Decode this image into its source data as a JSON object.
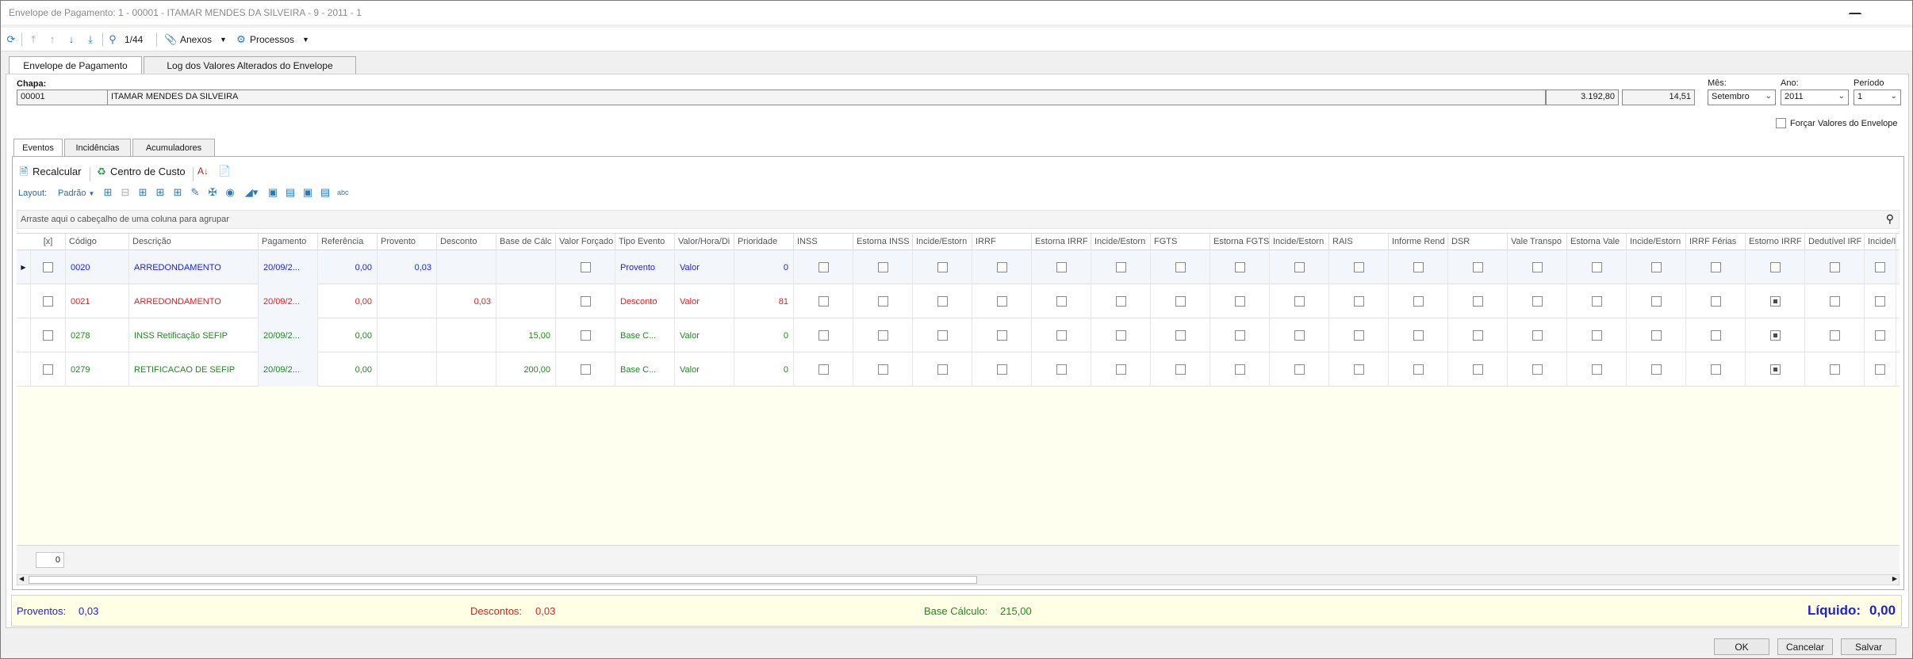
{
  "window": {
    "title": "Envelope de Pagamento: 1 - 00001 - ITAMAR MENDES DA SILVEIRA - 9 - 2011 - 1"
  },
  "toolbar": {
    "record_position": "1/44",
    "anexos": "Anexos",
    "processos": "Processos"
  },
  "main_tabs": [
    {
      "label": "Envelope de Pagamento"
    },
    {
      "label": "Log dos Valores Alterados do Envelope"
    }
  ],
  "header": {
    "chapa_label": "Chapa:",
    "chapa_value": "00001",
    "name": "ITAMAR MENDES DA SILVEIRA",
    "salary": "3.192,80",
    "hourly": "14,51",
    "mes_label": "Mês:",
    "mes_value": "Setembro",
    "ano_label": "Ano:",
    "ano_value": "2011",
    "periodo_label": "Período",
    "periodo_value": "1",
    "forcar_label": "Forçar Valores do Envelope"
  },
  "sub_tabs": [
    {
      "label": "Eventos"
    },
    {
      "label": "Incidências"
    },
    {
      "label": "Acumuladores"
    }
  ],
  "actions": {
    "recalcular": "Recalcular",
    "centro_custo": "Centro de Custo",
    "layout_label": "Layout:",
    "layout_value": "Padrão"
  },
  "grid": {
    "group_hint": "Arraste aqui o cabeçalho de uma coluna para agrupar",
    "columns": [
      "[x]",
      "Código",
      "Descrição",
      "Pagamento",
      "Referência",
      "Provento",
      "Desconto",
      "Base de Cálc",
      "Valor Forçado",
      "Tipo Evento",
      "Valor/Hora/Di",
      "Prioridade",
      "INSS",
      "Estorna INSS",
      "Incide/Estorn",
      "IRRF",
      "Estorna IRRF",
      "Incide/Estorn",
      "FGTS",
      "Estorna FGTS",
      "Incide/Estorn",
      "RAIS",
      "Informe Rend",
      "DSR",
      "Vale Transpo",
      "Estorna Vale",
      "Incide/Estorn",
      "IRRF Férias",
      "Estorno IRRF",
      "Dedutível IRF",
      "Incide/I"
    ],
    "rows": [
      {
        "codigo": "0020",
        "descricao": "ARREDONDAMENTO",
        "pagamento": "20/09/2...",
        "referencia": "0,00",
        "provento": "0,03",
        "desconto": "",
        "base": "",
        "tipo": "Provento",
        "valor_hora": "Valor",
        "prioridade": "0",
        "color": "#1f1fd6",
        "dedutivel": false
      },
      {
        "codigo": "0021",
        "descricao": "ARREDONDAMENTO",
        "pagamento": "20/09/2...",
        "referencia": "0,00",
        "provento": "",
        "desconto": "0,03",
        "base": "",
        "tipo": "Desconto",
        "valor_hora": "Valor",
        "prioridade": "81",
        "color": "#e02020",
        "dedutivel": true
      },
      {
        "codigo": "0278",
        "descricao": "INSS Retificação SEFIP",
        "pagamento": "20/09/2...",
        "referencia": "0,00",
        "provento": "",
        "desconto": "",
        "base": "15,00",
        "tipo": "Base C...",
        "valor_hora": "Valor",
        "prioridade": "0",
        "color": "#1f8a1f",
        "dedutivel": true
      },
      {
        "codigo": "0279",
        "descricao": "RETIFICACAO DE SEFIP",
        "pagamento": "20/09/2...",
        "referencia": "0,00",
        "provento": "",
        "desconto": "",
        "base": "200,00",
        "tipo": "Base C...",
        "valor_hora": "Valor",
        "prioridade": "0",
        "color": "#1f8a1f",
        "dedutivel": true
      }
    ],
    "record_count": "0"
  },
  "totals": {
    "proventos_label": "Proventos:",
    "proventos_value": "0,03",
    "descontos_label": "Descontos:",
    "descontos_value": "0,03",
    "base_label": "Base Cálculo:",
    "base_value": "215,00",
    "liquido_label": "Líquido:",
    "liquido_value": "0,00",
    "colors": {
      "proventos": "#1f1fd6",
      "descontos": "#e02020",
      "base": "#1f8a1f",
      "liquido": "#1f1fd6"
    }
  },
  "buttons": {
    "ok": "OK",
    "cancelar": "Cancelar",
    "salvar": "Salvar"
  }
}
